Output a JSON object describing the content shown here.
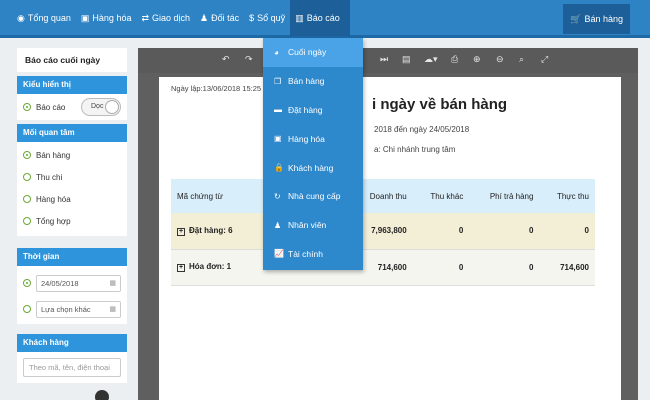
{
  "nav": {
    "items": [
      {
        "icon": "palette-icon",
        "glyph": "◉",
        "label": "Tổng quan"
      },
      {
        "icon": "box-icon",
        "glyph": "▣",
        "label": "Hàng hóa"
      },
      {
        "icon": "exchange-icon",
        "glyph": "⇄",
        "label": "Giao dịch"
      },
      {
        "icon": "person-icon",
        "glyph": "♟",
        "label": "Đối tác"
      },
      {
        "icon": "dollar-icon",
        "glyph": "$",
        "label": "Sổ quỹ"
      },
      {
        "icon": "bar-chart-icon",
        "glyph": "▥",
        "label": "Báo cáo"
      }
    ],
    "sale_button": "Bán hàng",
    "sale_glyph": "🛒"
  },
  "sidebar": {
    "title": "Báo cáo cuối ngày",
    "display": {
      "heading": "Kiểu hiển thị",
      "option": "Báo cáo",
      "toggle": "Dọc"
    },
    "concern": {
      "heading": "Mối quan tâm",
      "options": [
        "Bán hàng",
        "Thu chi",
        "Hàng hóa",
        "Tổng hợp"
      ]
    },
    "time": {
      "heading": "Thời gian",
      "date_value": "24/05/2018",
      "other_placeholder": "Lựa chọn khác",
      "cal_glyph": "▦"
    },
    "customer": {
      "heading": "Khách hàng",
      "placeholder": "Theo mã, tên, điện thoại"
    }
  },
  "dropdown": {
    "items": [
      {
        "icon": "pie-icon",
        "glyph": "◕",
        "label": "Cuối ngày",
        "selected": true
      },
      {
        "icon": "copy-icon",
        "glyph": "❐",
        "label": "Bán hàng"
      },
      {
        "icon": "inbox-icon",
        "glyph": "▬",
        "label": "Đặt hàng"
      },
      {
        "icon": "box-icon",
        "glyph": "▣",
        "label": "Hàng hóa"
      },
      {
        "icon": "lock-icon",
        "glyph": "🔒",
        "label": "Khách hàng"
      },
      {
        "icon": "refresh-icon",
        "glyph": "↻",
        "label": "Nhà cung cấp"
      },
      {
        "icon": "person-icon",
        "glyph": "♟",
        "label": "Nhân viên"
      },
      {
        "icon": "line-chart-icon",
        "glyph": "📈",
        "label": "Tài chính"
      }
    ]
  },
  "report": {
    "print_date": "Ngày lập:13/06/2018 15:25",
    "title": "i ngày về bán hàng",
    "subtitle1": "2018 đến ngày 24/05/2018",
    "subtitle2": "a: Chi nhánh trung tâm",
    "columns": [
      "Mã chứng từ",
      "Doanh thu",
      "Thu khác",
      "Phí trả hàng",
      "Thực thu"
    ],
    "rows": [
      {
        "label": "Đặt hàng: 6",
        "revenue": "7,963,800",
        "other": "0",
        "fee": "0",
        "actual": "0"
      },
      {
        "label": "Hóa đơn: 1",
        "revenue": "714,600",
        "other": "0",
        "fee": "0",
        "actual": "714,600"
      }
    ],
    "toolbar_icons": [
      {
        "name": "undo-icon",
        "glyph": "↶"
      },
      {
        "name": "redo-icon",
        "glyph": "↷"
      },
      {
        "name": "last-page-icon",
        "glyph": "⏭"
      },
      {
        "name": "file-icon",
        "glyph": "▤"
      },
      {
        "name": "cloud-download-icon",
        "glyph": "☁▾"
      },
      {
        "name": "print-icon",
        "glyph": "⎙"
      },
      {
        "name": "zoom-in-icon",
        "glyph": "⊕"
      },
      {
        "name": "zoom-out-icon",
        "glyph": "⊖"
      },
      {
        "name": "search-icon",
        "glyph": "⌕"
      },
      {
        "name": "fullscreen-icon",
        "glyph": "⤢"
      }
    ]
  }
}
